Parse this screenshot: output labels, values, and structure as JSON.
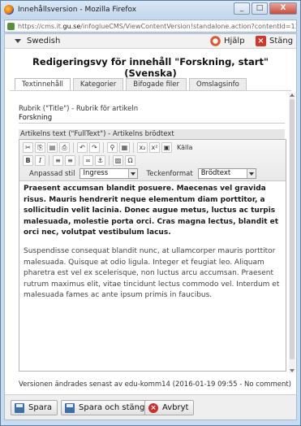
{
  "window": {
    "title": "Innehållsversion - Mozilla Firefox",
    "minimize": "_",
    "maximize": "□",
    "close": "X"
  },
  "url": {
    "prefix": "https://cms.it.",
    "host": "gu.se",
    "rest": "/infoglueCMS/ViewContentVersion!standalone.action?contentId=1352558&languageId"
  },
  "topbar": {
    "language": "Swedish",
    "help": "Hjälp",
    "close": "Stäng"
  },
  "page_title": "Redigeringsvy för innehåll \"Forskning, start\" (Svenska)",
  "tabs": [
    {
      "label": "Textinnehåll",
      "active": true
    },
    {
      "label": "Kategorier",
      "active": false
    },
    {
      "label": "Bifogade filer",
      "active": false
    },
    {
      "label": "Omslagsinfo",
      "active": false
    }
  ],
  "title_field": {
    "label": "Rubrik (\"Title\") - Rubrik för artikeln",
    "value": "Forskning"
  },
  "fulltext_label": "Artikelns text (\"FullText\") - Artikelns brödtext",
  "toolbar": {
    "row1": [
      "✂",
      "⎘",
      "▤",
      "⎙",
      "↶",
      "↷",
      "⚲",
      "▦",
      "x₂",
      "x²",
      "▣",
      "Källa"
    ],
    "row2": [
      "B",
      "I",
      "≡",
      "≡",
      "∞",
      "⚓",
      "▨",
      "Ω"
    ],
    "style_label": "Anpassad stil",
    "style_value": "Ingress",
    "format_label": "Teckenformat",
    "format_value": "Brödtext"
  },
  "editor": {
    "ingress": "Praesent accumsan blandit posuere. Maecenas vel gravida risus. Mauris hendrerit neque elementum diam porttitor, a sollicitudin velit lacinia. Donec augue metus, luctus ac turpis malesuada, molestie porta orci. Cras magna lectus, blandit et orci nec, volutpat vestibulum lacus.",
    "body": "Suspendisse consequat blandit nunc, at ullamcorper mauris porttitor malesuada. Quisque at odio ligula. Integer et feugiat leo. Aliquam pharetra est vel ex scelerisque, non luctus arcu accumsan. Praesent rutrum maximus elit, vitae tincidunt lectus commodo vel. Interdum et malesuada fames ac ante ipsum primis in faucibus."
  },
  "version_note": "Versionen ändrades senast av edu-komm14 (2016-01-19 09:55 - No comment)",
  "buttons": {
    "save": "Spara",
    "save_close": "Spara och stäng",
    "cancel": "Avbryt"
  }
}
